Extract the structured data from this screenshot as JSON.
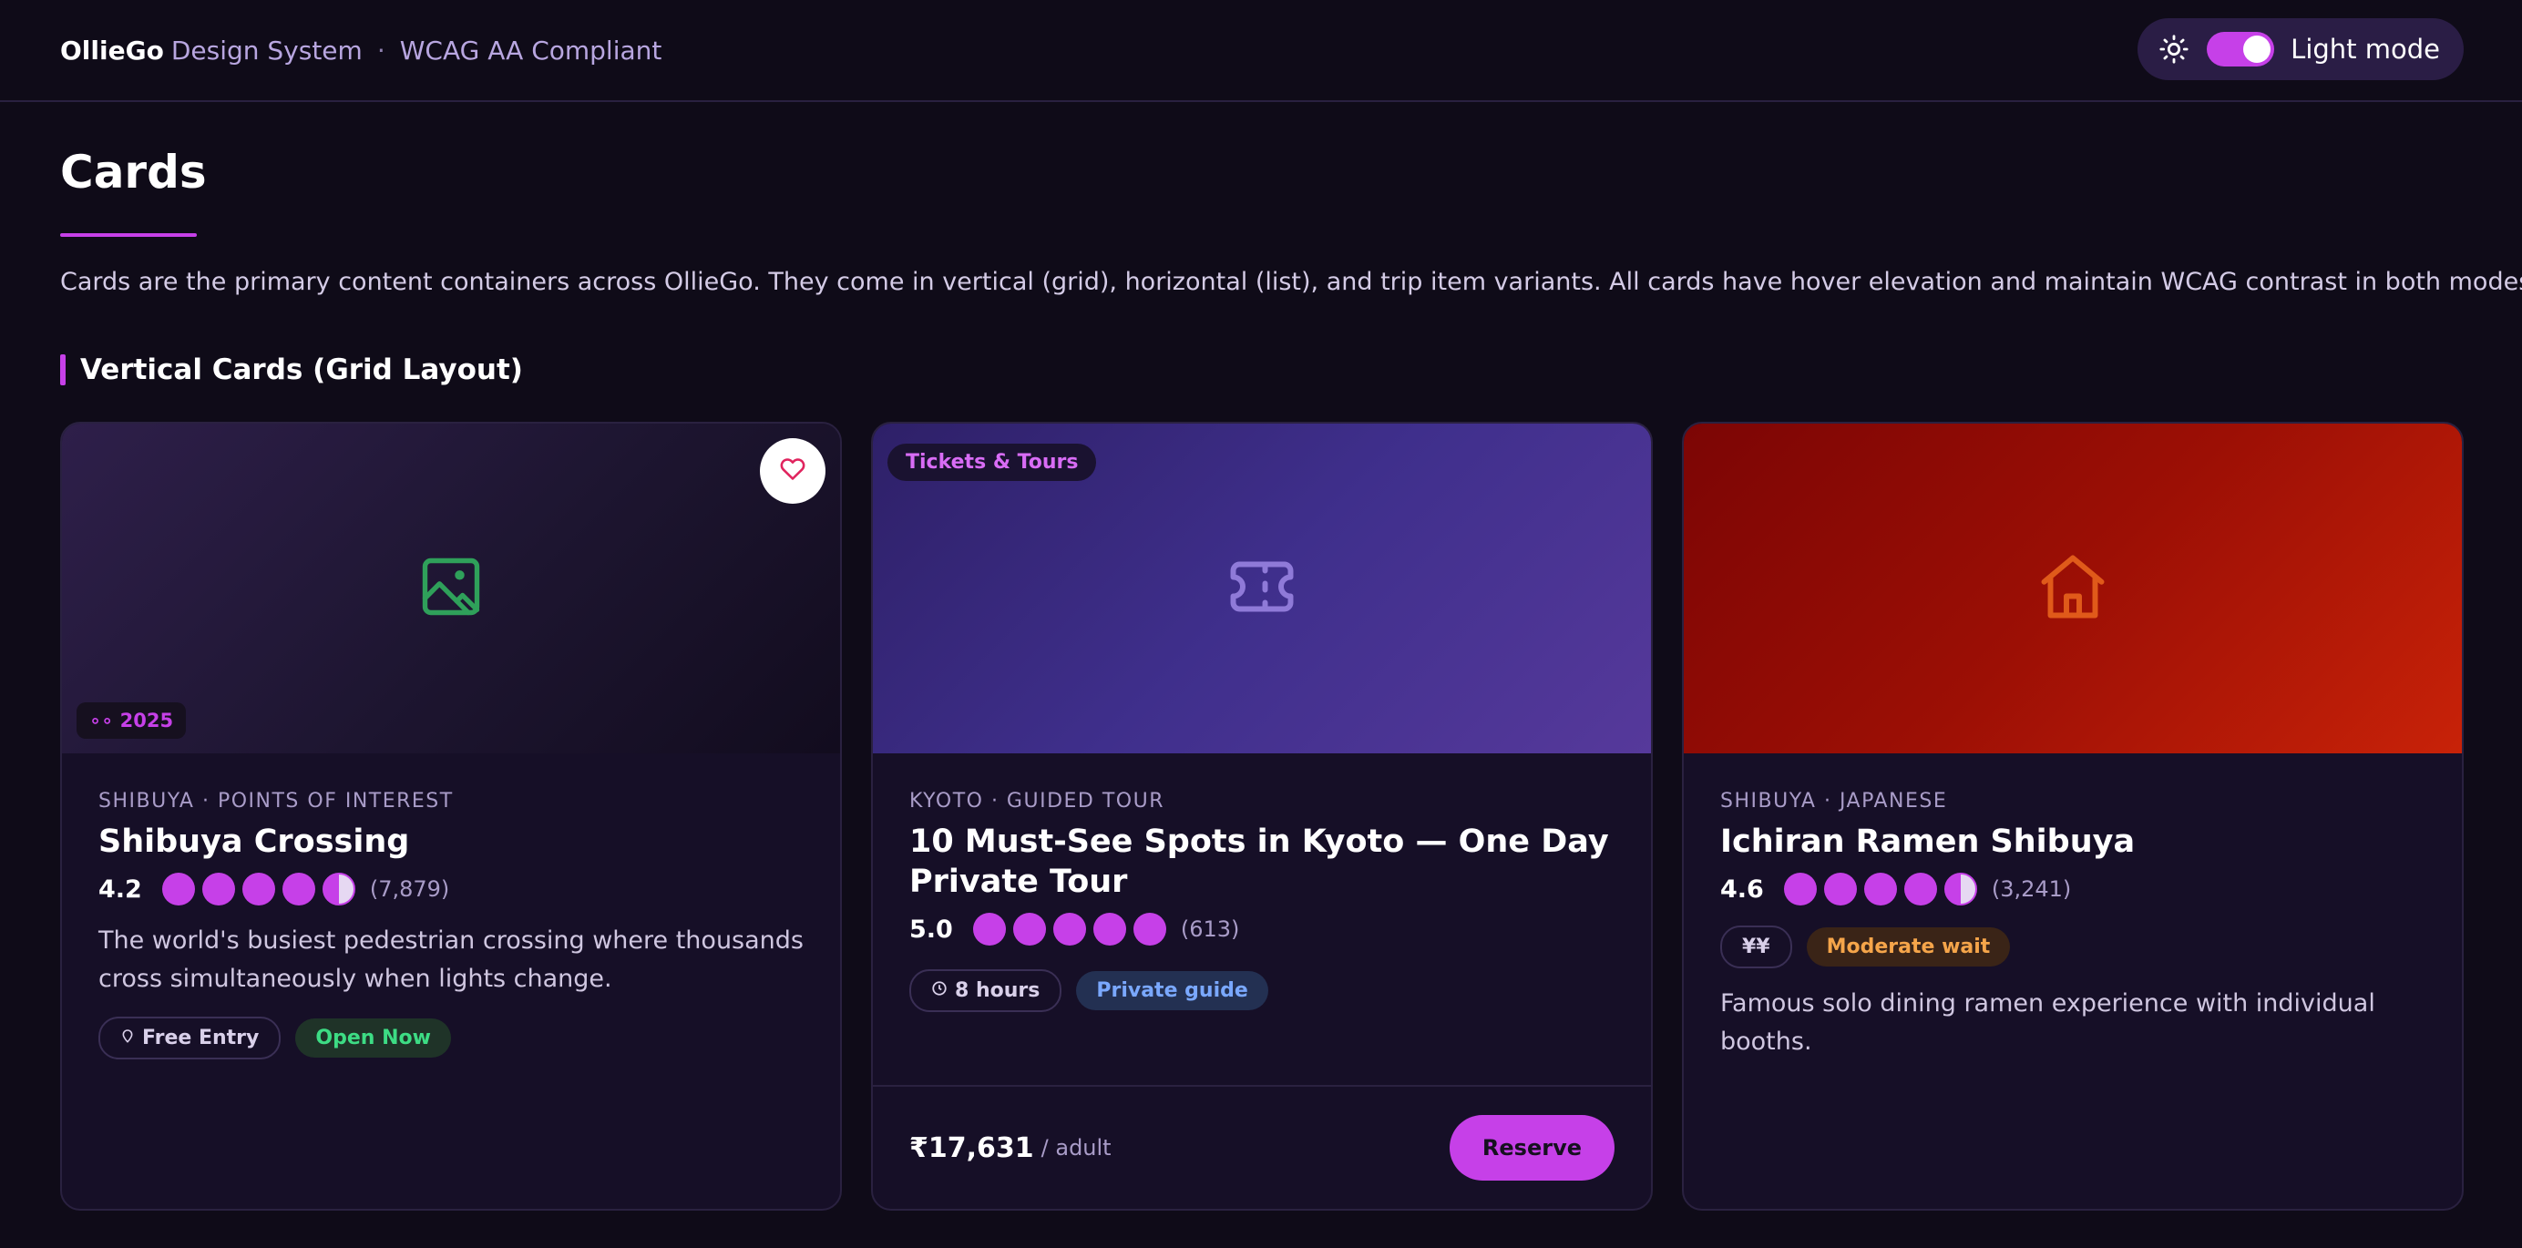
{
  "header": {
    "brand": "OllieGo",
    "subtitle": "Design System",
    "separator": "·",
    "badge": "WCAG AA Compliant",
    "theme_toggle_label": "Light mode"
  },
  "page": {
    "title": "Cards",
    "description": "Cards are the primary content containers across OllieGo. They come in vertical (grid), horizontal (list), and trip item variants. All cards have hover elevation and maintain WCAG contrast in both modes.",
    "section_title": "Vertical Cards (Grid Layout)"
  },
  "cards": [
    {
      "eyebrow": "SHIBUYA · POINTS OF INTEREST",
      "title": "Shibuya Crossing",
      "rating": "4.2",
      "rating_value": 4.5,
      "reviews": "(7,879)",
      "description": "The world's busiest pedestrian crossing where thousands cross simultaneously when lights change.",
      "badge": "∘∘ 2025",
      "icon": "image-icon",
      "chips": [
        "Free Entry",
        "Open Now"
      ]
    },
    {
      "eyebrow": "KYOTO · GUIDED TOUR",
      "title": "10 Must-See Spots in Kyoto — One Day Private Tour",
      "rating": "5.0",
      "rating_value": 5,
      "reviews": "(613)",
      "category": "Tickets & Tours",
      "icon": "ticket-icon",
      "chips": [
        "8 hours",
        "Private guide"
      ],
      "price": "₹17,631",
      "per": "/ adult",
      "cta": "Reserve"
    },
    {
      "eyebrow": "SHIBUYA · JAPANESE",
      "title": "Ichiran Ramen Shibuya",
      "rating": "4.6",
      "rating_value": 4.5,
      "reviews": "(3,241)",
      "description": "Famous solo dining ramen experience with individual booths.",
      "icon": "home-icon",
      "chips": [
        "¥¥",
        "Moderate wait"
      ]
    }
  ],
  "colors": {
    "accent": "#c640e8",
    "background": "#0f0b18",
    "card": "#160f27",
    "success": "#3ddc84",
    "info": "#7aa8ff",
    "warning": "#f5a54a"
  }
}
